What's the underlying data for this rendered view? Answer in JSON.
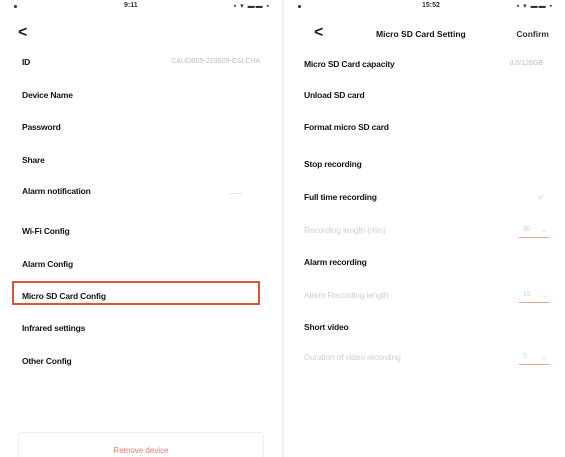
{
  "left": {
    "status": {
      "time": "9:11",
      "signal": "▪ ▾ ▬▬ ▪"
    },
    "back_glyph": "<",
    "rows": [
      {
        "label": "ID",
        "value": "CAUDB05-228509-CSLCHA"
      },
      {
        "label": "Device Name",
        "value": ""
      },
      {
        "label": "Password",
        "value": ""
      },
      {
        "label": "Share",
        "value": ""
      },
      {
        "label": "Alarm notification",
        "value": ""
      },
      {
        "label": "Wi-Fi Config",
        "value": ""
      },
      {
        "label": "Alarm Config",
        "value": ""
      },
      {
        "label": "Micro SD Card Config",
        "value": ""
      },
      {
        "label": "Infrared settings",
        "value": ""
      },
      {
        "label": "Other Config",
        "value": ""
      }
    ],
    "remove_button": "Remove device",
    "accent_color": "#e0552b"
  },
  "right": {
    "status": {
      "time": "15:52",
      "signal": "▪ ▾ ▬▬ ▪"
    },
    "back_glyph": "<",
    "title": "Micro SD Card Setting",
    "confirm": "Confirm",
    "rows": [
      {
        "label": "Micro SD Card capacity",
        "value": "0.0/128GB",
        "faded": false
      },
      {
        "label": "Unload SD card",
        "faded": false
      },
      {
        "label": "Format micro SD card",
        "faded": false
      },
      {
        "label": "Stop recording",
        "faded": false
      },
      {
        "label": "Full time recording",
        "faded": false,
        "check": "✓"
      },
      {
        "label": "Recording length (min)",
        "faded": true,
        "select": "30"
      },
      {
        "label": "Alarm recording",
        "faded": false
      },
      {
        "label": "Alarm Recording length",
        "faded": true,
        "select": "15"
      },
      {
        "label": "Short video",
        "faded": false
      },
      {
        "label": "Duration of video recording",
        "faded": true,
        "select": "5"
      }
    ]
  }
}
